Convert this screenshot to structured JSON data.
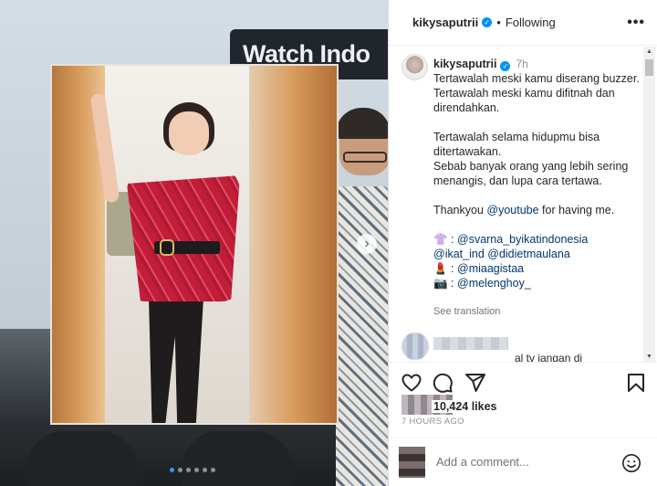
{
  "media": {
    "background_text": "Watch Indo",
    "carousel_dots": 6,
    "active_dot": 0
  },
  "post": {
    "username": "kikysaputrii",
    "follow_status": "Following",
    "separator": "•",
    "more_label": "•••",
    "caption": {
      "time": "7h",
      "lines": [
        "Tertawalah meski kamu diserang buzzer.",
        "Tertawalah meski kamu difitnah dan direndahkan.",
        "",
        "Tertawalah selama hidupmu bisa ditertawakan.",
        "Sebab banyak orang yang lebih sering menangis, dan lupa cara tertawa.",
        ""
      ],
      "thanks_prefix": "Thankyou ",
      "thanks_mention": "@youtube",
      "thanks_suffix": " for having me.",
      "credit_1_icon": "👚",
      "credit_1_mention": "@svarna_byikatindonesia",
      "credit_1_line2_a": "@ikat_ind",
      "credit_1_line2_b": "@didietmaulana",
      "credit_sep": " : ",
      "credit_2_icon": "💄",
      "credit_2_mention": "@miaagistaa",
      "credit_3_icon": "📷",
      "credit_3_mention": "@melenghoy_"
    },
    "see_translation": "See translation",
    "partial_comment": "al tv jangan di",
    "likes": "10,424 likes",
    "timestamp": "7 HOURS AGO",
    "comment_placeholder": "Add a comment..."
  },
  "colors": {
    "link": "#00376b",
    "verified": "#0095f6",
    "muted": "#8e8e8e"
  },
  "icons": [
    "heart-icon",
    "comment-icon",
    "share-icon",
    "bookmark-icon",
    "emoji-icon",
    "verified-icon",
    "chevron-right-icon",
    "more-icon"
  ]
}
